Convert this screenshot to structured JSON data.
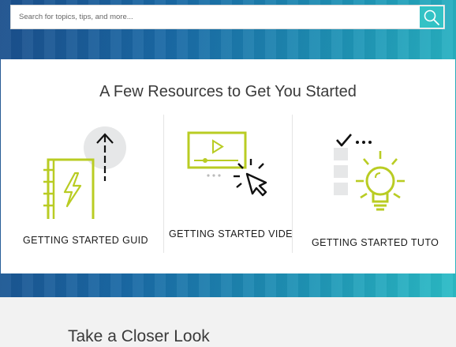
{
  "search": {
    "placeholder": "Search for topics, tips, and more...",
    "icon": "search-icon"
  },
  "colors": {
    "accent": "#33c2c5",
    "icon_lime": "#b9cc23",
    "hero_gradient_start": "#1b4f8c",
    "hero_gradient_end": "#2bbcc6"
  },
  "resources": {
    "title": "A Few Resources to Get You Started",
    "items": [
      {
        "label": "GETTING STARTED GUID",
        "icon": "notebook-lightning-icon"
      },
      {
        "label": "GETTING STARTED VIDE",
        "icon": "video-cursor-icon"
      },
      {
        "label": "GETTING STARTED TUTO",
        "icon": "checklist-lightbulb-icon"
      }
    ]
  },
  "closer_look": {
    "title": "Take a Closer Look"
  }
}
